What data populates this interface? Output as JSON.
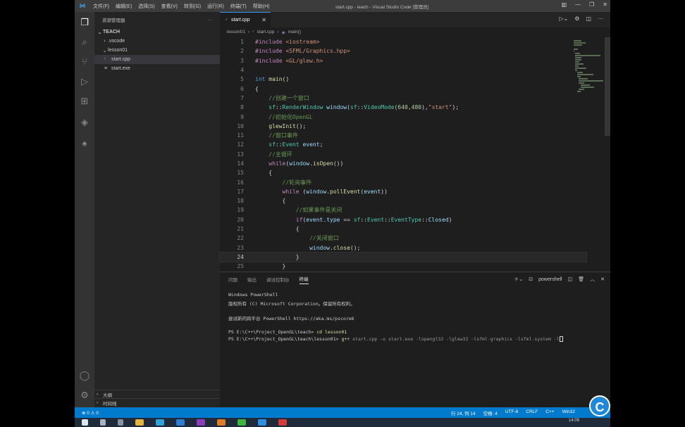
{
  "titlebar": {
    "menus": [
      "文件(F)",
      "编辑(E)",
      "选择(S)",
      "查看(V)",
      "转到(G)",
      "运行(R)",
      "终端(T)",
      "帮助(H)"
    ],
    "title": "start.cpp - teach - Visual Studio Code [管理员]"
  },
  "sidebar": {
    "header": "资源管理器",
    "more": "···",
    "root": "TEACH",
    "items": [
      {
        "label": ".vscode",
        "kind": "folder",
        "expanded": false
      },
      {
        "label": "lesson01",
        "kind": "folder",
        "expanded": true
      },
      {
        "label": "start.cpp",
        "kind": "cpp-file",
        "selected": true
      },
      {
        "label": "start.exe",
        "kind": "exe-file",
        "selected": false
      }
    ],
    "outline": "大纲",
    "timeline": "时间线"
  },
  "editor": {
    "tab": "start.cpp",
    "breadcrumb": [
      "lesson01",
      "start.cpp",
      "main()"
    ],
    "current_line": 24,
    "lines": [
      "#include <iostream>",
      "#include <SFML/Graphics.hpp>",
      "#include <GL/glew.h>",
      "",
      "int main()",
      "{",
      "    //创建一个窗口",
      "    sf::RenderWindow window(sf::VideoMode(640,480),\"start\");",
      "    //初始化OpenGL",
      "    glewInit();",
      "    //窗口事件",
      "    sf::Event event;",
      "    //主循环",
      "    while(window.isOpen())",
      "    {",
      "        //轮询事件",
      "        while (window.pollEvent(event))",
      "        {",
      "            //如果事件是关闭",
      "            if(event.type == sf::Event::EventType::Closed)",
      "            {",
      "                //关闭窗口",
      "                window.close();",
      "            }",
      "        }"
    ]
  },
  "panel": {
    "tabs": [
      "问题",
      "输出",
      "调试控制台",
      "终端"
    ],
    "active_tab": "终端",
    "terminal_name": "powershell",
    "terminal_lines": [
      "Windows PowerShell",
      "版权所有 (C) Microsoft Corporation。保留所有权利。",
      "",
      "尝试新的跨平台 PowerShell https://aka.ms/pscore6",
      "",
      "PS E:\\C++\\Project_OpenGL\\teach> cd lesson01",
      "PS E:\\C++\\Project_OpenGL\\teach\\lesson01> g++ start.cpp -o start.exe -lopengl32 -lglew32 -lsfml-graphics -lsfml-system -l"
    ]
  },
  "statusbar": {
    "problems": "⊗ 0 ⚠ 0",
    "position": "行 24, 列 14",
    "spaces": "空格: 4",
    "encoding": "UTF-8",
    "eol": "CRLF",
    "language": "C++",
    "platform": "Win32"
  },
  "taskbar": {
    "time": "14:09"
  },
  "colors": {
    "accent": "#007acc",
    "editor_bg": "#1e1e1e",
    "sidebar_bg": "#252526"
  }
}
